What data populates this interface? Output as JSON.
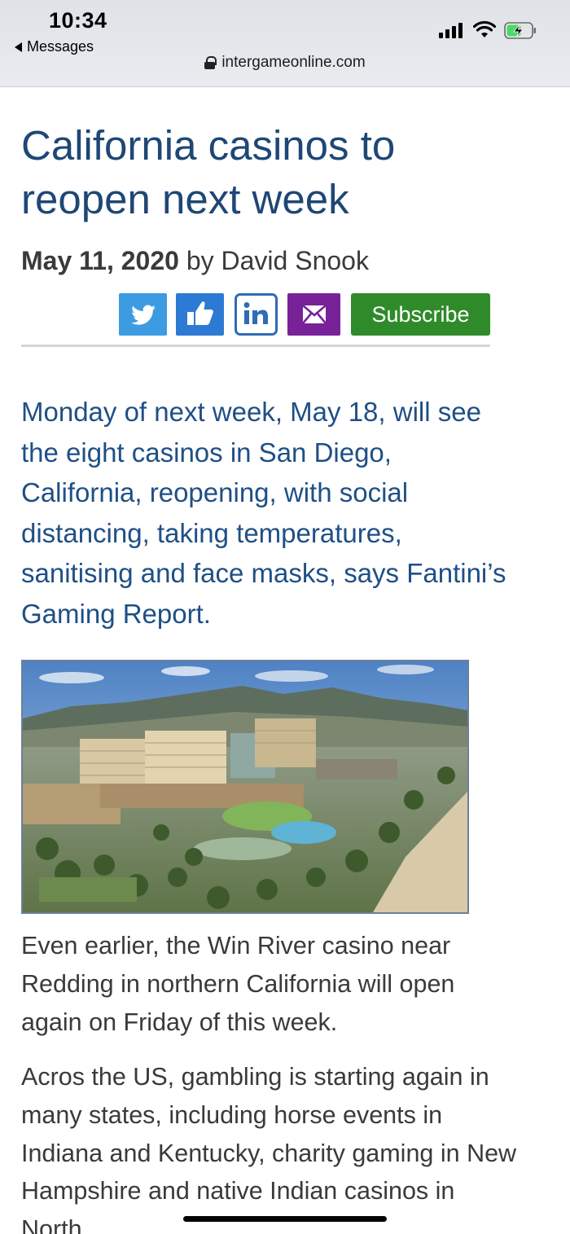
{
  "status": {
    "time": "10:34",
    "back_label": "Messages"
  },
  "browser": {
    "url": "intergameonline.com"
  },
  "article": {
    "title": "California casinos to reopen next week",
    "date": "May 11, 2020",
    "by": "by",
    "author": "David Snook",
    "lead": "Monday of next week, May 18, will see the eight casinos in San Diego, California, reopening, with social distancing, taking temperatures, sanitising and face masks, says Fantini’s Gaming Report.",
    "paragraphs": [
      "Even earlier, the Win River casino near Redding in northern California will open again on Friday of this week.",
      "Acros the US, gambling is starting again in many states, including horse events in Indiana and Kentucky, charity gaming in New Hampshire and native Indian casinos in North"
    ]
  },
  "share": {
    "buttons": [
      {
        "icon": "twitter-icon",
        "color": "#3d9be2"
      },
      {
        "icon": "facebook-like-icon",
        "color": "#2c7ad3"
      },
      {
        "icon": "linkedin-icon",
        "color": "#2e6cb5"
      },
      {
        "icon": "email-icon",
        "color": "#78229a"
      }
    ],
    "subscribe_label": "Subscribe",
    "subscribe_color": "#2f8b2a"
  },
  "colors": {
    "title": "#1e4775",
    "lead": "#1f4f86",
    "body_text": "#3a3a3a"
  }
}
